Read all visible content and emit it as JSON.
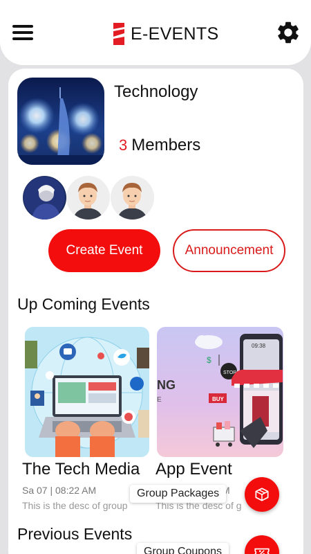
{
  "app": {
    "title": "E-EVENTS",
    "accent_color": "#f30d0d",
    "icons": {
      "menu": "hamburger-menu-icon",
      "settings": "gear-icon",
      "logo": "brand-logo-icon"
    }
  },
  "group": {
    "name": "Technology",
    "member_count": "3",
    "member_label": "Members",
    "avatars": [
      "member-photo-avatar",
      "member-cartoon-avatar",
      "member-cartoon-avatar"
    ]
  },
  "actions": {
    "create_event": "Create Event",
    "announcement": "Announcement"
  },
  "upcoming": {
    "title": "Up Coming Events",
    "events": [
      {
        "title": "The Tech Media",
        "date": "Sa 07 | 08:22 AM",
        "desc": "This is the desc of group"
      },
      {
        "title": "App Event",
        "date": "M",
        "desc": "This is the desc of g"
      }
    ]
  },
  "app_event_banner": {
    "partial_text_1": "NG",
    "partial_text_2": "E",
    "store_sign": "STORE",
    "buy_sign": "BUY",
    "phone_time": "09:38"
  },
  "previous": {
    "title": "Previous Events"
  },
  "fab_menu": {
    "group_packages": "Group Packages",
    "group_coupons": "Group Coupons",
    "icons": [
      "package-icon",
      "coupon-icon"
    ]
  }
}
